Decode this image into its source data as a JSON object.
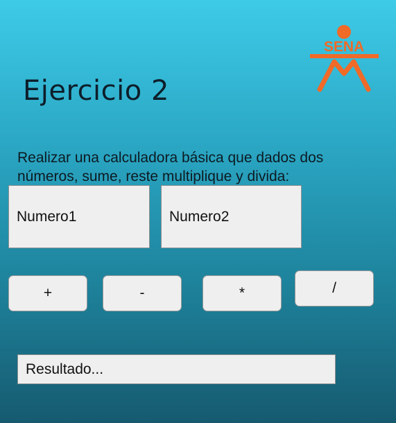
{
  "header": {
    "title": "Ejercicio 2",
    "logo_text": "SENA",
    "logo_color": "#f06a28"
  },
  "description": "Realizar una calculadora básica que dados dos números, sume, reste multiplique y divida:",
  "inputs": {
    "numero1_placeholder": "Numero1",
    "numero2_placeholder": "Numero2",
    "result_placeholder": "Resultado..."
  },
  "buttons": {
    "add": "+",
    "subtract": "-",
    "multiply": "*",
    "divide": "/"
  }
}
